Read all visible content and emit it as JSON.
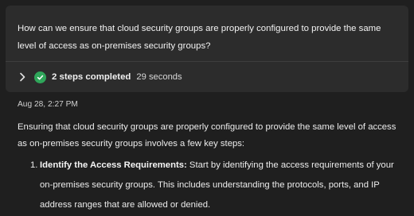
{
  "prompt": {
    "text": "How can we ensure that cloud security groups are properly configured to provide the same level of access as on-premises security groups?"
  },
  "steps": {
    "expand_icon": "chevron-right-icon",
    "status_icon": "check-circle-icon",
    "status_color": "#2fa65a",
    "label": "2 steps completed",
    "duration": "29 seconds"
  },
  "response": {
    "timestamp": "Aug 28, 2:27 PM",
    "intro": "Ensuring that cloud security groups are properly configured to provide the same level of access as on-premises security groups involves a few key steps:",
    "items": [
      {
        "number": "1.",
        "title": "Identify the Access Requirements:",
        "text": " Start by identifying the access requirements of your on-premises security groups. This includes understanding the protocols, ports, and IP address ranges that are allowed or denied."
      }
    ]
  }
}
